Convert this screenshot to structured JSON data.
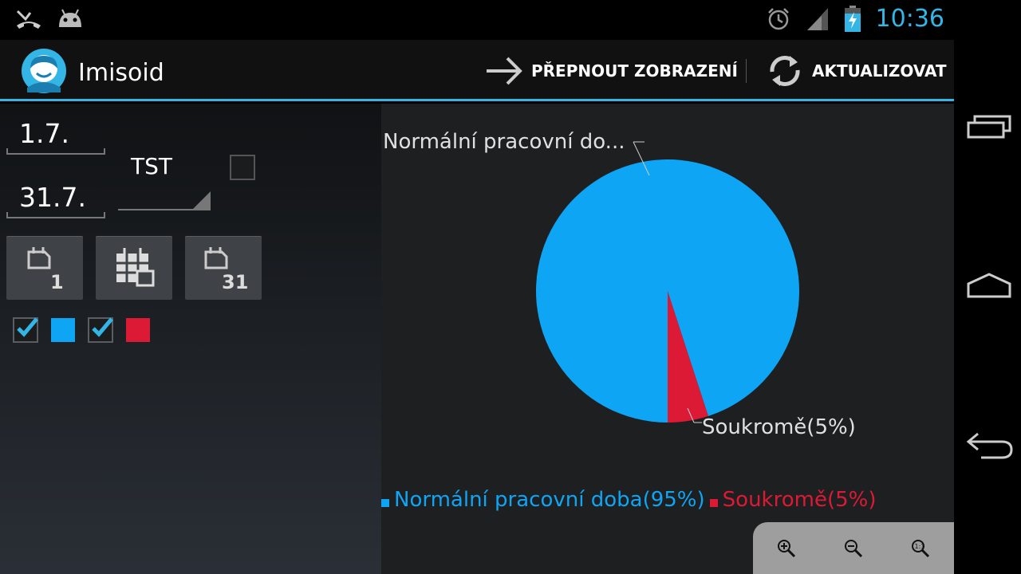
{
  "status_bar": {
    "time": "10:36",
    "icons": [
      "missed-call-icon",
      "android-icon",
      "alarm-icon",
      "signal-icon",
      "battery-charging-icon"
    ]
  },
  "action_bar": {
    "title": "Imisoid",
    "actions": [
      {
        "label": "PŘEPNOUT ZOBRAZENÍ",
        "icon": "arrow-right-icon"
      },
      {
        "label": "AKTUALIZOVAT",
        "icon": "refresh-icon"
      }
    ]
  },
  "filters": {
    "date_from": "1.7.",
    "date_to": "31.7.",
    "tst_label": "TST",
    "tst_checked": false,
    "calendar_buttons": [
      {
        "icon": "calendar-day-icon",
        "label": "1"
      },
      {
        "icon": "calendar-month-icon",
        "label": ""
      },
      {
        "icon": "calendar-last-day-icon",
        "label": "31"
      }
    ],
    "series_toggles": [
      {
        "checked": true,
        "color": "#0ea5f5"
      },
      {
        "checked": true,
        "color": "#dc1a35"
      }
    ]
  },
  "chart_data": {
    "type": "pie",
    "slices": [
      {
        "label": "Normální pracovní doba",
        "value": 95,
        "color": "#0ea5f5"
      },
      {
        "label": "Soukromě",
        "value": 5,
        "color": "#dc1a35"
      }
    ],
    "slice_labels": [
      "Normální pracovní do...",
      "Soukromě(5%)"
    ],
    "legend": [
      "Normální pracovní doba(95%)",
      "Soukromě(5%)"
    ],
    "legend_position": "bottom-left"
  },
  "zoom": {
    "icons": [
      "zoom-in-icon",
      "zoom-out-icon",
      "zoom-reset-icon"
    ]
  },
  "nav_bar": {
    "icons": [
      "recent-apps-icon",
      "home-icon",
      "back-icon"
    ]
  }
}
